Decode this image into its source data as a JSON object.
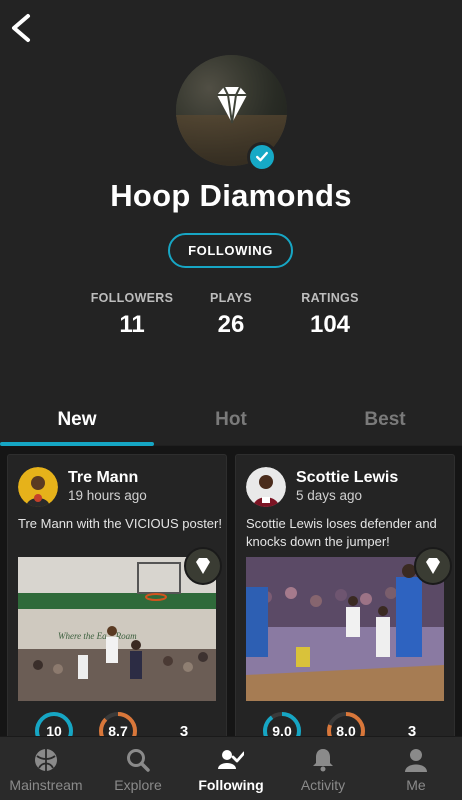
{
  "profile": {
    "name": "Hoop Diamonds",
    "follow_label": "FOLLOWING",
    "verified": true
  },
  "stats": [
    {
      "label": "FOLLOWERS",
      "value": "11"
    },
    {
      "label": "PLAYS",
      "value": "26"
    },
    {
      "label": "RATINGS",
      "value": "104"
    }
  ],
  "tabs": {
    "items": [
      {
        "label": "New",
        "active": true
      },
      {
        "label": "Hot",
        "active": false
      },
      {
        "label": "Best",
        "active": false
      }
    ]
  },
  "posts": [
    {
      "name": "Tre Mann",
      "time": "19 hours ago",
      "description": "Tre Mann with the VICIOUS poster!",
      "rating_1": "10",
      "rating_2": "8.7",
      "count": "3"
    },
    {
      "name": "Scottie Lewis",
      "time": "5 days ago",
      "description": "Scottie Lewis loses defender and knocks down the jumper!",
      "rating_1": "9.0",
      "rating_2": "8.0",
      "count": "3"
    }
  ],
  "bottom_nav": {
    "items": [
      {
        "label": "Mainstream",
        "icon": "mainstream-icon",
        "active": false
      },
      {
        "label": "Explore",
        "icon": "search-icon",
        "active": false
      },
      {
        "label": "Following",
        "icon": "following-icon",
        "active": true
      },
      {
        "label": "Activity",
        "icon": "bell-icon",
        "active": false
      },
      {
        "label": "Me",
        "icon": "person-icon",
        "active": false
      }
    ]
  },
  "colors": {
    "accent": "#16a6c4",
    "secondary_accent": "#d9773a",
    "background": "#1f1f1f"
  }
}
